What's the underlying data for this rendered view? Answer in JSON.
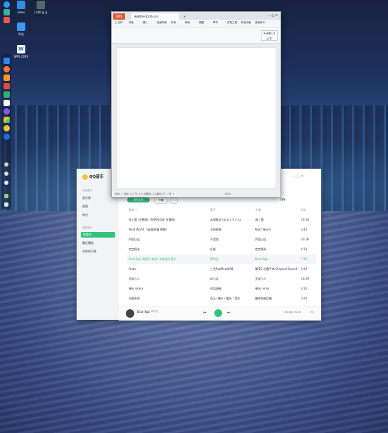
{
  "desktop": {
    "icons": [
      {
        "label": "edrei"
      },
      {
        "label": "(14)l.jp g"
      },
      {
        "label": "学业"
      },
      {
        "label": "WPS 2019"
      }
    ]
  },
  "wps": {
    "tab_home": "WPS",
    "tab_doc": "新建Word文档.doc",
    "tab_add": "+",
    "menu": [
      "三 文件",
      "开始",
      "插入",
      "页面布局",
      "引用",
      "审阅",
      "视图",
      "章节",
      "开发工具",
      "特色功能",
      "查找命令"
    ],
    "status_left": "页码: 1  页面: 1/1  节: 1/1  设置值: 2.5厘米  行: 1  列: 1",
    "zoom": "100%",
    "style_label": "AaBbCcI",
    "style_name": "正文"
  },
  "qq": {
    "logo": "QQ音乐",
    "sidebar": {
      "section1": "在线音乐",
      "items1": [
        "音乐馆",
        "视频",
        "电台"
      ],
      "section2": "我的音乐",
      "items2": [
        "我喜欢",
        "最近播放",
        "本地和下载"
      ]
    },
    "toolbar": {
      "play_all": "播放全部",
      "download": "下载",
      "batch": "批量",
      "sort": "排序"
    },
    "columns": {
      "song": "歌曲 1",
      "artist": "歌手",
      "album": "专辑",
      "duration": "时长"
    },
    "songs": [
      {
        "title": "海上鹿 (完整版) (拉萨的河流 日落版)",
        "artist": "本周歌词 (まるぐりとん)",
        "album": "海上鹿",
        "duration": "10:39"
      },
      {
        "title": "Next World 《英雄联盟 明朗》",
        "artist": "羊群歌唱",
        "album": "Next World",
        "duration": "3:49"
      },
      {
        "title": "声笛以远",
        "artist": "千里鱼",
        "album": "声笛以远",
        "duration": "10:28"
      },
      {
        "title": "定定情未",
        "artist": "任彬",
        "album": "定定情未",
        "duration": "4:38"
      },
      {
        "title": "Dual Ego 海浮5 (电台) 玄机唱片音乐",
        "artist": "萨尔瓦",
        "album": "Dual Ego",
        "duration": "7:36"
      },
      {
        "title": "Outlo",
        "artist": "三芝Redflow/轩辉",
        "album": "繁荣5.启霸不休-Original Soundt...",
        "duration": "3:06"
      },
      {
        "title": "无双六人",
        "artist": "风七北",
        "album": "无双六人",
        "duration": "10:39"
      },
      {
        "title": "弹出 remix",
        "artist": "何浩源屋",
        "album": "弹出 remix",
        "duration": "3:16"
      },
      {
        "title": "四量草草",
        "artist": "百玉 (骞衫 / 晨光 / 西方",
        "album": "翻转啦曲目集",
        "duration": "3:06"
      }
    ],
    "player": {
      "title": "Dual Ego",
      "artist": "萨尔瓦",
      "time": "00:44 / 02:30",
      "lyric_btn": "词",
      "quality": "HQ"
    },
    "accent": "#31c27c"
  }
}
